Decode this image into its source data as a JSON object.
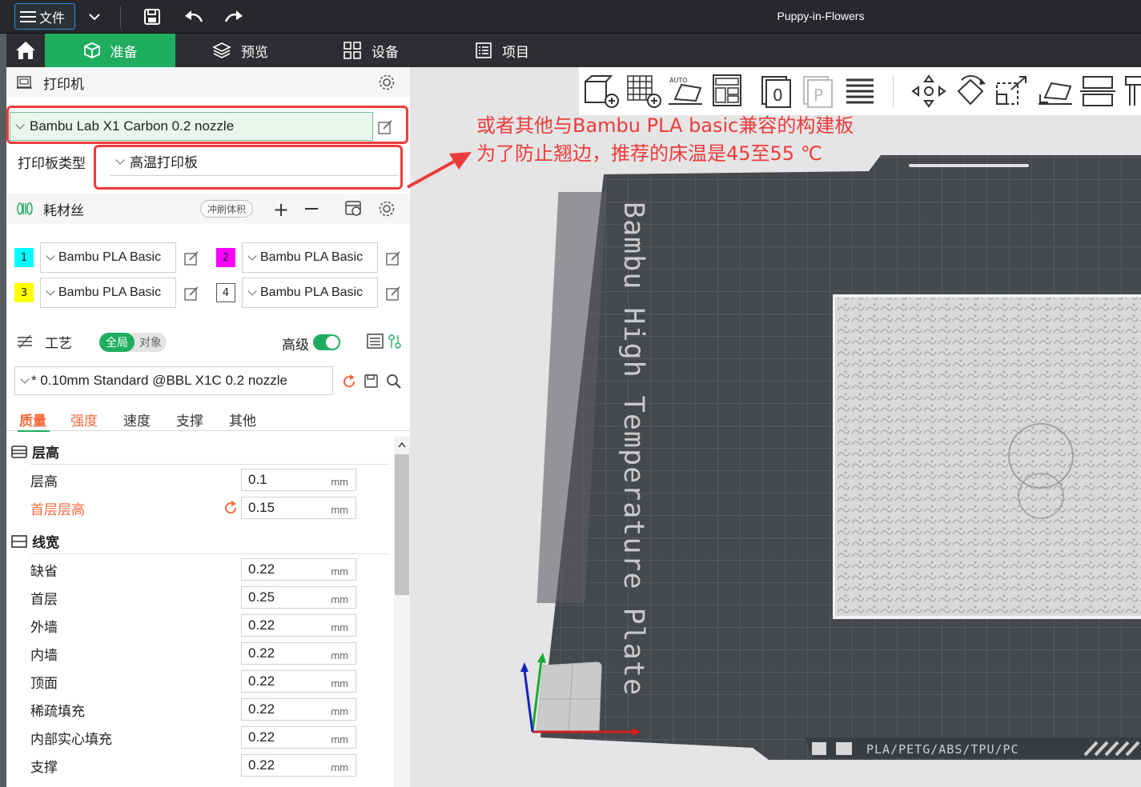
{
  "titlebar": {
    "file_label": "文件",
    "window_title": "Puppy-in-Flowers"
  },
  "tabs": {
    "prepare": "准备",
    "preview": "预览",
    "device": "设备",
    "project": "项目"
  },
  "printer": {
    "section_title": "打印机",
    "preset": "Bambu Lab X1 Carbon 0.2 nozzle",
    "plate_label": "打印板类型",
    "plate_value": "高温打印板"
  },
  "filament": {
    "section_title": "耗材丝",
    "flush_label": "冲刷体积",
    "slots": [
      {
        "num": "1",
        "name": "Bambu PLA Basic",
        "color": "#00ffff"
      },
      {
        "num": "2",
        "name": "Bambu PLA Basic",
        "color": "#ff00ff"
      },
      {
        "num": "3",
        "name": "Bambu PLA Basic",
        "color": "#ffff00"
      },
      {
        "num": "4",
        "name": "Bambu PLA Basic",
        "color": "#ffffff"
      }
    ]
  },
  "process": {
    "section_title": "工艺",
    "toggle_global": "全局",
    "toggle_object": "对象",
    "advanced_label": "高级",
    "preset": "* 0.10mm Standard @BBL X1C 0.2 nozzle",
    "tabs": [
      "质量",
      "强度",
      "速度",
      "支撑",
      "其他"
    ],
    "layer_height": {
      "title": "层高",
      "rows": [
        {
          "label": "层高",
          "value": "0.1",
          "unit": "mm"
        },
        {
          "label": "首层层高",
          "value": "0.15",
          "unit": "mm"
        }
      ]
    },
    "line_width": {
      "title": "线宽",
      "rows": [
        {
          "label": "缺省",
          "value": "0.22",
          "unit": "mm"
        },
        {
          "label": "首层",
          "value": "0.25",
          "unit": "mm"
        },
        {
          "label": "外墙",
          "value": "0.22",
          "unit": "mm"
        },
        {
          "label": "内墙",
          "value": "0.22",
          "unit": "mm"
        },
        {
          "label": "顶面",
          "value": "0.22",
          "unit": "mm"
        },
        {
          "label": "稀疏填充",
          "value": "0.22",
          "unit": "mm"
        },
        {
          "label": "内部实心填充",
          "value": "0.22",
          "unit": "mm"
        },
        {
          "label": "支撑",
          "value": "0.22",
          "unit": "mm"
        }
      ]
    }
  },
  "annotation": {
    "line1": "或者其他与Bambu PLA basic兼容的构建板",
    "line2": "为了防止翘边，推荐的床温是45至55 ℃"
  },
  "plate": {
    "label": "Bambu High Temperature Plate",
    "materials": "PLA/PETG/ABS/TPU/PC"
  },
  "colors": {
    "accent_green": "#1fad5f",
    "annotation_red": "#ee3b3b",
    "modified_orange": "#f26a3d"
  }
}
